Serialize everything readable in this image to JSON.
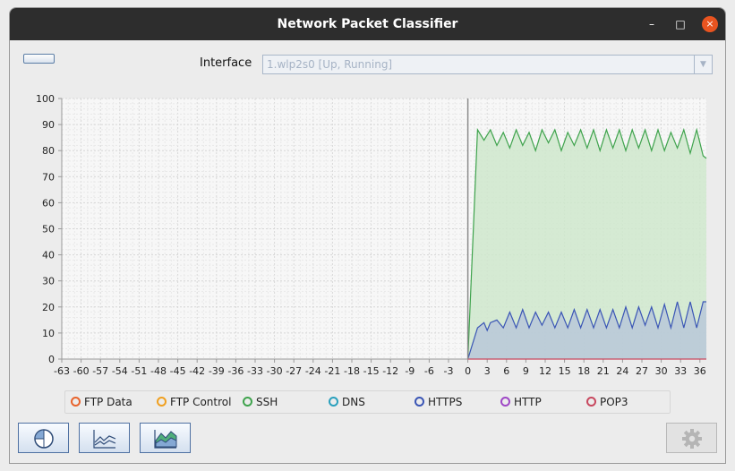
{
  "window": {
    "title": "Network Packet Classifier",
    "minimize": "–",
    "maximize": "□",
    "close": "×"
  },
  "controls": {
    "interface_label": "Interface",
    "interface_value": "1.wlp2s0 [Up, Running]",
    "dropdown_arrow": "▼"
  },
  "chart_data": {
    "type": "area",
    "title": "",
    "xlabel": "",
    "ylabel": "",
    "xlim": [
      -63,
      37
    ],
    "ylim": [
      0,
      100
    ],
    "x_ticks": [
      "-63",
      "-60",
      "-57",
      "-54",
      "-51",
      "-48",
      "-45",
      "-42",
      "-39",
      "-36",
      "-33",
      "-30",
      "-27",
      "-24",
      "-21",
      "-18",
      "-15",
      "-12",
      "-9",
      "-6",
      "-3",
      "0",
      "3",
      "6",
      "9",
      "12",
      "15",
      "18",
      "21",
      "24",
      "27",
      "30",
      "33",
      "36"
    ],
    "y_ticks": [
      "0",
      "10",
      "20",
      "30",
      "40",
      "50",
      "60",
      "70",
      "80",
      "90",
      "100"
    ],
    "grid": true,
    "series": [
      {
        "name": "SSH",
        "color": "#3fa34d",
        "fill": "#cfe8cc",
        "x": [
          0,
          1.5,
          2.5,
          3.5,
          4.5,
          5.5,
          6.5,
          7.5,
          8.5,
          9.5,
          10.5,
          11.5,
          12.5,
          13.5,
          14.5,
          15.5,
          16.5,
          17.5,
          18.5,
          19.5,
          20.5,
          21.5,
          22.5,
          23.5,
          24.5,
          25.5,
          26.5,
          27.5,
          28.5,
          29.5,
          30.5,
          31.5,
          32.5,
          33.5,
          34.5,
          35.5,
          36.5,
          37
        ],
        "values": [
          0,
          88,
          84,
          88,
          82,
          87,
          81,
          88,
          82,
          87,
          80,
          88,
          83,
          88,
          80,
          87,
          82,
          88,
          81,
          88,
          80,
          88,
          81,
          88,
          80,
          88,
          81,
          88,
          80,
          88,
          80,
          87,
          81,
          88,
          79,
          88,
          78,
          77
        ]
      },
      {
        "name": "HTTPS",
        "color": "#3a55b5",
        "fill": "#b9c8d8",
        "x": [
          0,
          1.5,
          2.5,
          3,
          3.5,
          4.5,
          5.5,
          6.5,
          7.5,
          8.5,
          9.5,
          10.5,
          11.5,
          12.5,
          13.5,
          14.5,
          15.5,
          16.5,
          17.5,
          18.5,
          19.5,
          20.5,
          21.5,
          22.5,
          23.5,
          24.5,
          25.5,
          26.5,
          27.5,
          28.5,
          29.5,
          30.5,
          31.5,
          32.5,
          33.5,
          34.5,
          35.5,
          36.5,
          37
        ],
        "values": [
          0,
          12,
          14,
          11,
          14,
          15,
          12,
          18,
          12,
          19,
          12,
          18,
          13,
          18,
          12,
          18,
          12,
          19,
          12,
          19,
          12,
          19,
          12,
          19,
          12,
          20,
          12,
          20,
          13,
          20,
          12,
          21,
          12,
          22,
          12,
          22,
          12,
          22,
          22
        ]
      },
      {
        "name": "POP3",
        "color": "#c8485f",
        "fill": "none",
        "x": [
          0,
          37
        ],
        "values": [
          0,
          0
        ]
      }
    ],
    "legend": [
      {
        "name": "FTP Data",
        "color": "#e8632c"
      },
      {
        "name": "FTP Control",
        "color": "#f0a020"
      },
      {
        "name": "SSH",
        "color": "#3fa34d"
      },
      {
        "name": "DNS",
        "color": "#2aa0bd"
      },
      {
        "name": "HTTPS",
        "color": "#3a55b5"
      },
      {
        "name": "HTTP",
        "color": "#9e47c6"
      },
      {
        "name": "POP3",
        "color": "#c8485f"
      }
    ],
    "legend_position": "bottom"
  },
  "toolbar": {
    "icons": [
      "pie-chart-icon",
      "line-chart-icon",
      "area-chart-icon",
      "gear-icon"
    ]
  }
}
